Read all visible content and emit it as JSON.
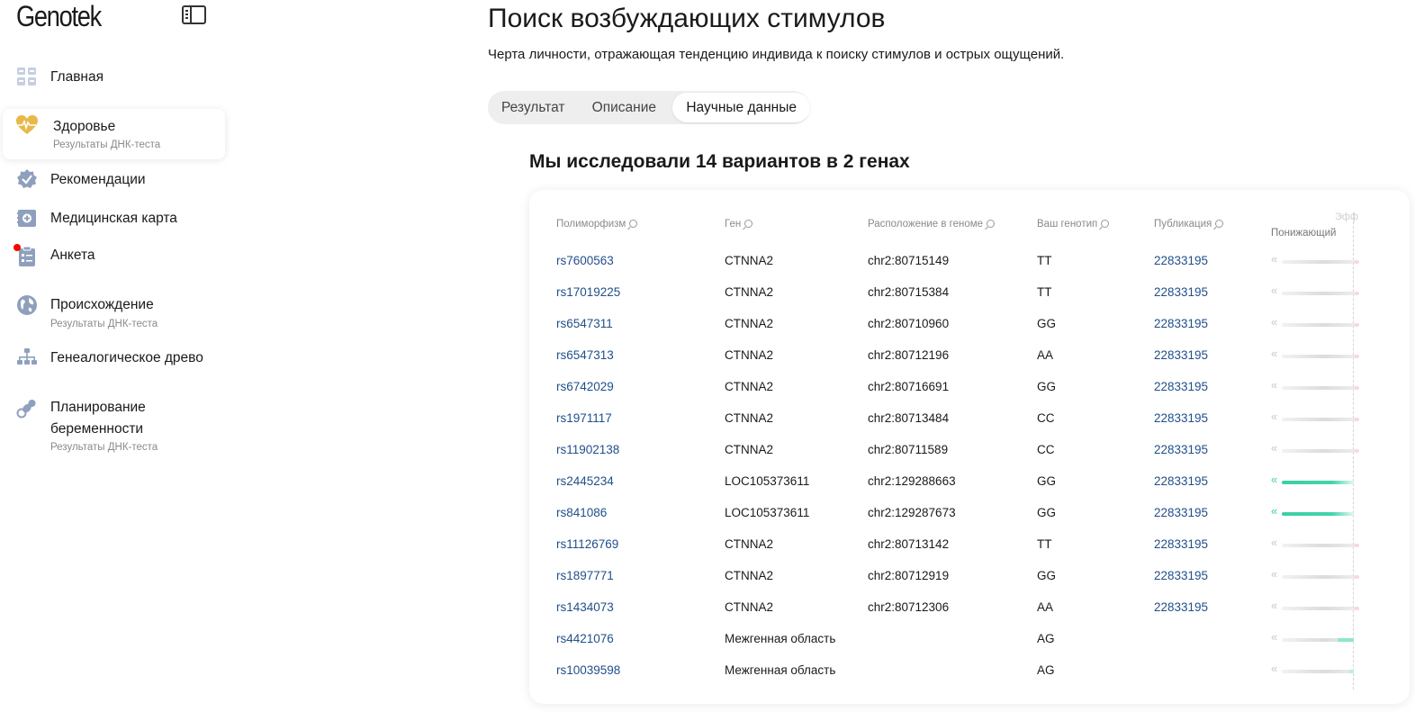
{
  "app": {
    "logo": "Genotek"
  },
  "sidebar": {
    "items": [
      {
        "label": "Главная",
        "sub": ""
      },
      {
        "label": "Здоровье",
        "sub": "Результаты ДНК-теста"
      },
      {
        "label": "Рекомендации",
        "sub": ""
      },
      {
        "label": "Медицинская карта",
        "sub": ""
      },
      {
        "label": "Анкета",
        "sub": ""
      },
      {
        "label": "Происхождение",
        "sub": "Результаты ДНК-теста"
      },
      {
        "label": "Генеалогическое древо",
        "sub": ""
      },
      {
        "label": "Планирование беременности",
        "sub": "Результаты ДНК-теста"
      }
    ],
    "accent_color": "#e8b84a",
    "icon_color": "#8ea0bd",
    "notification_color": "#ff0000"
  },
  "page": {
    "title": "Поиск возбуждающих стимулов",
    "description": "Черта личности, отражающая тенденцию индивида к поиску стимулов и острых ощущений.",
    "tabs": [
      {
        "label": "Результат",
        "active": false
      },
      {
        "label": "Описание",
        "active": false
      },
      {
        "label": "Научные данные",
        "active": true
      }
    ],
    "section_title": "Мы исследовали 14 вариантов в 2 генах"
  },
  "table": {
    "headers": {
      "polymorphism": "Полиморфизм",
      "gene": "Ген",
      "location": "Расположение в геноме",
      "genotype": "Ваш генотип",
      "publication": "Публикация",
      "effect": "Эфф",
      "effect_low": "Понижающий"
    },
    "rows": [
      {
        "snp": "rs7600563",
        "gene": "CTNNA2",
        "location": "chr2:80715149",
        "genotype": "TT",
        "publication": "22833195",
        "effect": "neutral"
      },
      {
        "snp": "rs17019225",
        "gene": "CTNNA2",
        "location": "chr2:80715384",
        "genotype": "TT",
        "publication": "22833195",
        "effect": "neutral"
      },
      {
        "snp": "rs6547311",
        "gene": "CTNNA2",
        "location": "chr2:80710960",
        "genotype": "GG",
        "publication": "22833195",
        "effect": "neutral"
      },
      {
        "snp": "rs6547313",
        "gene": "CTNNA2",
        "location": "chr2:80712196",
        "genotype": "AA",
        "publication": "22833195",
        "effect": "neutral"
      },
      {
        "snp": "rs6742029",
        "gene": "CTNNA2",
        "location": "chr2:80716691",
        "genotype": "GG",
        "publication": "22833195",
        "effect": "neutral"
      },
      {
        "snp": "rs1971117",
        "gene": "CTNNA2",
        "location": "chr2:80713484",
        "genotype": "CC",
        "publication": "22833195",
        "effect": "neutral"
      },
      {
        "snp": "rs11902138",
        "gene": "CTNNA2",
        "location": "chr2:80711589",
        "genotype": "CC",
        "publication": "22833195",
        "effect": "neutral"
      },
      {
        "snp": "rs2445234",
        "gene": "LOC105373611",
        "location": "chr2:129288663",
        "genotype": "GG",
        "publication": "22833195",
        "effect": "decreasing"
      },
      {
        "snp": "rs841086",
        "gene": "LOC105373611",
        "location": "chr2:129287673",
        "genotype": "GG",
        "publication": "22833195",
        "effect": "decreasing"
      },
      {
        "snp": "rs11126769",
        "gene": "CTNNA2",
        "location": "chr2:80713142",
        "genotype": "TT",
        "publication": "22833195",
        "effect": "neutral"
      },
      {
        "snp": "rs1897771",
        "gene": "CTNNA2",
        "location": "chr2:80712919",
        "genotype": "GG",
        "publication": "22833195",
        "effect": "neutral"
      },
      {
        "snp": "rs1434073",
        "gene": "CTNNA2",
        "location": "chr2:80712306",
        "genotype": "AA",
        "publication": "22833195",
        "effect": "neutral"
      },
      {
        "snp": "rs4421076",
        "gene": "Межгенная область",
        "location": "",
        "genotype": "AG",
        "publication": "",
        "effect": "slight"
      },
      {
        "snp": "rs10039598",
        "gene": "Межгенная область",
        "location": "",
        "genotype": "AG",
        "publication": "",
        "effect": "trace"
      }
    ],
    "effect_colors": {
      "decreasing": "#3ccfa4",
      "neutral": "#dcdcdc",
      "increasing": "#f7d9e2"
    }
  }
}
